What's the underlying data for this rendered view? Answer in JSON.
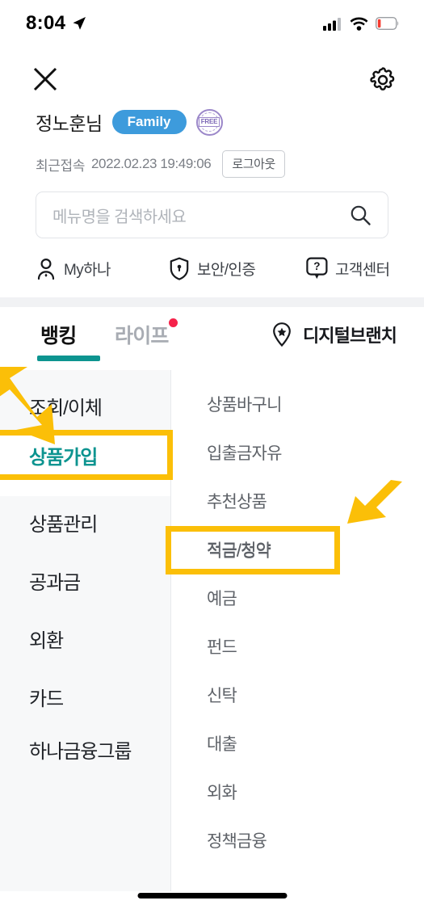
{
  "status_bar": {
    "time": "8:04",
    "location_icon": "location-arrow-icon",
    "signal_icon": "cellular-signal-icon",
    "wifi_icon": "wifi-icon",
    "battery_icon": "battery-low-icon",
    "battery_color": "#f53b2f"
  },
  "header": {
    "close_icon": "close-icon",
    "settings_icon": "gear-icon"
  },
  "user": {
    "name": "정노훈님",
    "membership_badge": "Family",
    "membership_color": "#3d9bdc",
    "free_badge": "FREE",
    "free_badge_color": "#7b66b5",
    "last_access_label": "최근접속",
    "last_access_time": "2022.02.23 19:49:06",
    "logout_label": "로그아웃"
  },
  "search": {
    "placeholder": "메뉴명을 검색하세요",
    "icon": "search-icon"
  },
  "quick_links": [
    {
      "label": "My하나",
      "icon": "person-icon"
    },
    {
      "label": "보안/인증",
      "icon": "shield-icon"
    },
    {
      "label": "고객센터",
      "icon": "question-bubble-icon"
    }
  ],
  "tabs": {
    "items": [
      {
        "label": "뱅킹",
        "active": true
      },
      {
        "label": "라이프",
        "active": false,
        "dot": true
      }
    ],
    "active_color": "#0d9490",
    "branch": {
      "label": "디지털브랜치",
      "icon": "location-pin-star-icon"
    }
  },
  "menu": {
    "categories": [
      {
        "label": "조회/이체",
        "selected": false
      },
      {
        "label": "상품가입",
        "selected": true
      },
      {
        "label": "상품관리",
        "selected": false
      },
      {
        "label": "공과금",
        "selected": false
      },
      {
        "label": "외환",
        "selected": false
      },
      {
        "label": "카드",
        "selected": false
      },
      {
        "label": "하나금융그룹",
        "selected": false
      }
    ],
    "subitems": [
      {
        "label": "상품바구니",
        "highlighted": false
      },
      {
        "label": "입출금자유",
        "highlighted": false
      },
      {
        "label": "추천상품",
        "highlighted": false
      },
      {
        "label": "적금/청약",
        "highlighted": true
      },
      {
        "label": "예금",
        "highlighted": false
      },
      {
        "label": "펀드",
        "highlighted": false
      },
      {
        "label": "신탁",
        "highlighted": false
      },
      {
        "label": "대출",
        "highlighted": false
      },
      {
        "label": "외화",
        "highlighted": false
      },
      {
        "label": "정책금융",
        "highlighted": false
      }
    ]
  },
  "annotations": {
    "color": "#fbbf08",
    "highlight_targets": [
      "상품가입",
      "적금/청약"
    ],
    "arrow_count": 2
  }
}
